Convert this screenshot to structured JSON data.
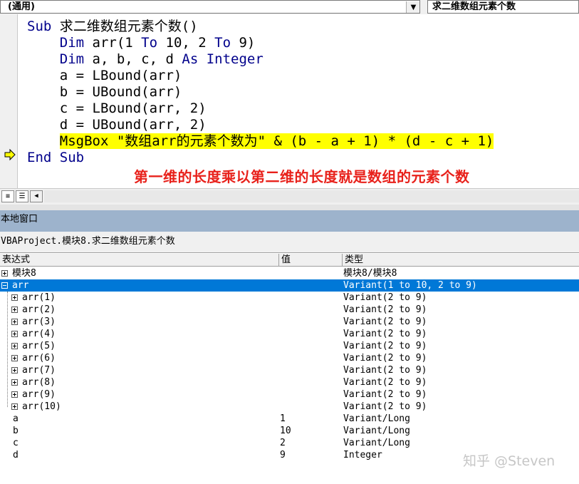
{
  "object_combo": {
    "value": "(通用)"
  },
  "procedure_combo": {
    "value": "求二维数组元素个数"
  },
  "code": {
    "lines": [
      {
        "indent": "",
        "kw": "Sub",
        "rest": " 求二维数组元素个数()"
      },
      {
        "indent": "    ",
        "kw": "Dim",
        "rest": " arr(1 ",
        "kw2": "To",
        "rest2": " 10, 2 ",
        "kw3": "To",
        "rest3": " 9)"
      },
      {
        "indent": "    ",
        "kw": "Dim",
        "rest": " a, b, c, d ",
        "kw2": "As",
        "rest2": " ",
        "kw3": "Integer",
        "rest3": ""
      },
      {
        "indent": "    ",
        "text": "a = LBound(arr)"
      },
      {
        "indent": "    ",
        "text": "b = UBound(arr)"
      },
      {
        "indent": "    ",
        "text": "c = LBound(arr, 2)"
      },
      {
        "indent": "    ",
        "text": "d = UBound(arr, 2)"
      },
      {
        "indent": "    ",
        "text": "MsgBox \"数组arr的元素个数为\" & (b - a + 1) * (d - c + 1)"
      },
      {
        "indent": "",
        "kw": "End",
        "rest": " ",
        "kw2": "Sub",
        "rest2": ""
      }
    ],
    "annotation": "第一维的长度乘以第二维的长度就是数组的元素个数"
  },
  "locals": {
    "title": "本地窗口",
    "context": "VBAProject.模块8.求二维数组元素个数",
    "columns": {
      "expr": "表达式",
      "value": "值",
      "type": "类型"
    },
    "rows": [
      {
        "expr": "模块8",
        "value": "",
        "type": "模块8/模块8",
        "expander": "plus",
        "level": 0
      },
      {
        "expr": "arr",
        "value": "",
        "type": "Variant(1 to 10, 2 to 9)",
        "expander": "minus",
        "level": 0,
        "selected": true
      },
      {
        "expr": "arr(1)",
        "value": "",
        "type": "Variant(2 to 9)",
        "expander": "plus",
        "level": 1
      },
      {
        "expr": "arr(2)",
        "value": "",
        "type": "Variant(2 to 9)",
        "expander": "plus",
        "level": 1
      },
      {
        "expr": "arr(3)",
        "value": "",
        "type": "Variant(2 to 9)",
        "expander": "plus",
        "level": 1
      },
      {
        "expr": "arr(4)",
        "value": "",
        "type": "Variant(2 to 9)",
        "expander": "plus",
        "level": 1
      },
      {
        "expr": "arr(5)",
        "value": "",
        "type": "Variant(2 to 9)",
        "expander": "plus",
        "level": 1
      },
      {
        "expr": "arr(6)",
        "value": "",
        "type": "Variant(2 to 9)",
        "expander": "plus",
        "level": 1
      },
      {
        "expr": "arr(7)",
        "value": "",
        "type": "Variant(2 to 9)",
        "expander": "plus",
        "level": 1
      },
      {
        "expr": "arr(8)",
        "value": "",
        "type": "Variant(2 to 9)",
        "expander": "plus",
        "level": 1
      },
      {
        "expr": "arr(9)",
        "value": "",
        "type": "Variant(2 to 9)",
        "expander": "plus",
        "level": 1
      },
      {
        "expr": "arr(10)",
        "value": "",
        "type": "Variant(2 to 9)",
        "expander": "plus",
        "level": 1
      },
      {
        "expr": "a",
        "value": "1",
        "type": "Variant/Long",
        "expander": "none",
        "level": 0
      },
      {
        "expr": "b",
        "value": "10",
        "type": "Variant/Long",
        "expander": "none",
        "level": 0
      },
      {
        "expr": "c",
        "value": "2",
        "type": "Variant/Long",
        "expander": "none",
        "level": 0
      },
      {
        "expr": "d",
        "value": "9",
        "type": "Integer",
        "expander": "none",
        "level": 0
      }
    ]
  },
  "watermark": "知乎 @Steven",
  "colors": {
    "keyword": "#00008b",
    "highlight": "#ffff00",
    "annotation": "#e8211b",
    "selection": "#0078d7",
    "locals_title_bg": "#9db3cc"
  },
  "icons": {
    "current_line": "yellow-arrow-icon",
    "combo_dropdown": "chevron-down-icon"
  }
}
